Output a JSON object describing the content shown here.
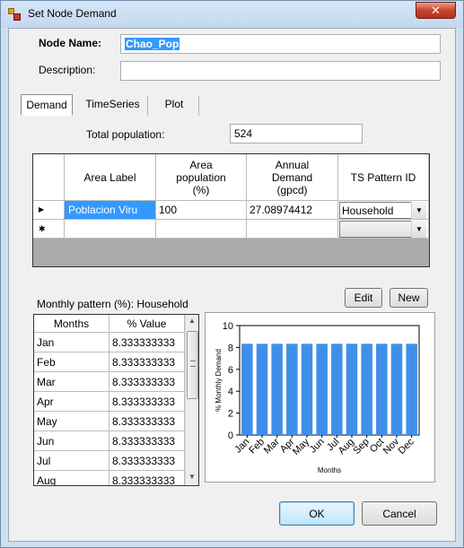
{
  "window": {
    "title": "Set Node Demand",
    "close_glyph": "✕"
  },
  "form": {
    "node_name_label": "Node Name:",
    "node_name_value": "Chao_Pop",
    "description_label": "Description:",
    "description_value": ""
  },
  "tabs": [
    {
      "label": "Demand",
      "active": true
    },
    {
      "label": "TimeSeries",
      "active": false
    },
    {
      "label": "Plot",
      "active": false
    }
  ],
  "demand": {
    "total_population_label": "Total population:",
    "total_population_value": "524",
    "grid": {
      "columns": [
        "Area Label",
        "Area\npopulation\n(%)",
        "Annual\nDemand\n(gpcd)",
        "TS Pattern ID"
      ],
      "rows": [
        {
          "marker": "▶",
          "area_label": "Poblacion Viru",
          "area_population": "100",
          "annual_demand": "27.08974412",
          "pattern": "Household"
        },
        {
          "marker": "✱",
          "area_label": "",
          "area_population": "",
          "annual_demand": "",
          "pattern": ""
        }
      ]
    }
  },
  "monthly": {
    "label": "Monthly pattern (%): Household",
    "edit_button": "Edit",
    "new_button": "New",
    "columns": [
      "Months",
      "% Value"
    ],
    "rows": [
      {
        "month": "Jan",
        "value": "8.333333333"
      },
      {
        "month": "Feb",
        "value": "8.333333333"
      },
      {
        "month": "Mar",
        "value": "8.333333333"
      },
      {
        "month": "Apr",
        "value": "8.333333333"
      },
      {
        "month": "May",
        "value": "8.333333333"
      },
      {
        "month": "Jun",
        "value": "8.333333333"
      },
      {
        "month": "Jul",
        "value": "8.333333333"
      },
      {
        "month": "Aug",
        "value": "8.333333333"
      }
    ]
  },
  "chart_data": {
    "type": "bar",
    "categories": [
      "Jan",
      "Feb",
      "Mar",
      "Apr",
      "May",
      "Jun",
      "Jul",
      "Aug",
      "Sep",
      "Oct",
      "Nov",
      "Dec"
    ],
    "values": [
      8.333333333,
      8.333333333,
      8.333333333,
      8.333333333,
      8.333333333,
      8.333333333,
      8.333333333,
      8.333333333,
      8.333333333,
      8.333333333,
      8.333333333,
      8.333333333
    ],
    "title": "",
    "xlabel": "Months",
    "ylabel": "% Monthly Demand",
    "ylim": [
      0,
      10
    ],
    "yticks": [
      0,
      2,
      4,
      6,
      8,
      10
    ],
    "bar_color": "#3f8fea",
    "grid": false
  },
  "buttons": {
    "ok": "OK",
    "cancel": "Cancel"
  },
  "colors": {
    "selection": "#3399ff",
    "window_frame": "#cfdff0",
    "close_button": "#c7432e"
  }
}
